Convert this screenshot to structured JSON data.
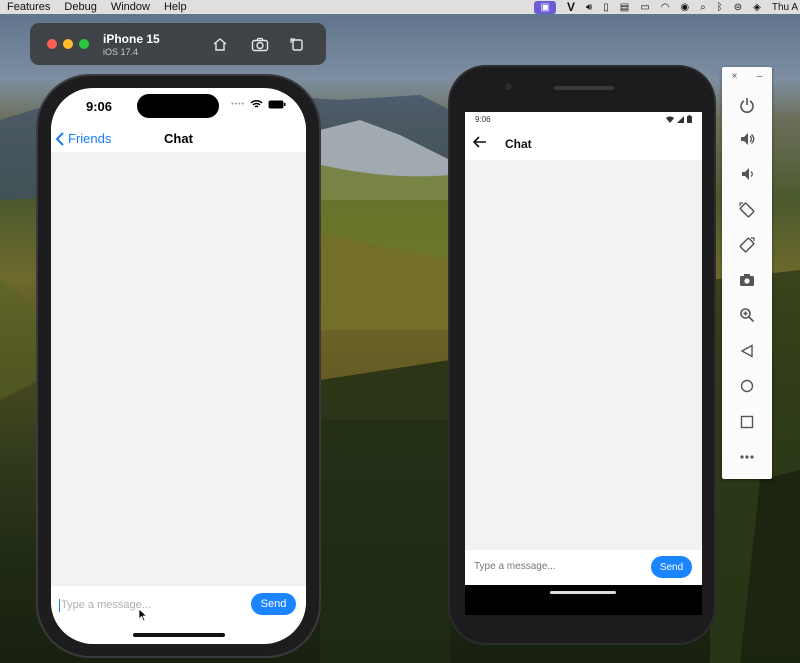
{
  "menubar": {
    "items": [
      "Features",
      "Debug",
      "Window",
      "Help"
    ],
    "clock": "Thu A",
    "status_icons": [
      "screen-share-icon",
      "v-icon",
      "volume-icon",
      "battery-case-icon",
      "display-icon",
      "battery-icon",
      "wifi-icon",
      "user-icon",
      "search-icon",
      "bluetooth-icon",
      "control-center-icon",
      "siri-icon"
    ]
  },
  "simulator_toolbar": {
    "device_name": "iPhone 15",
    "os_version": "iOS 17.4",
    "buttons": [
      "home-icon",
      "screenshot-icon",
      "rotate-icon"
    ]
  },
  "iphone": {
    "time": "9:06",
    "nav": {
      "back_label": "Friends",
      "title": "Chat"
    },
    "input_placeholder": "Type a message...",
    "send_label": "Send"
  },
  "android": {
    "time": "9:06",
    "title": "Chat",
    "input_placeholder": "Type a message...",
    "send_label": "Send"
  },
  "emulator_panel": {
    "close": "×",
    "minimize": "–",
    "buttons": [
      "power-icon",
      "volume-up-icon",
      "volume-down-icon",
      "rotate-left-icon",
      "rotate-right-icon",
      "camera-icon",
      "zoom-icon",
      "back-icon",
      "home-circle-icon",
      "overview-icon",
      "more-icon"
    ]
  },
  "colors": {
    "accent": "#1a85ff",
    "ios_back": "#1a7cf5",
    "chat_bg": "#f2f2f4"
  }
}
